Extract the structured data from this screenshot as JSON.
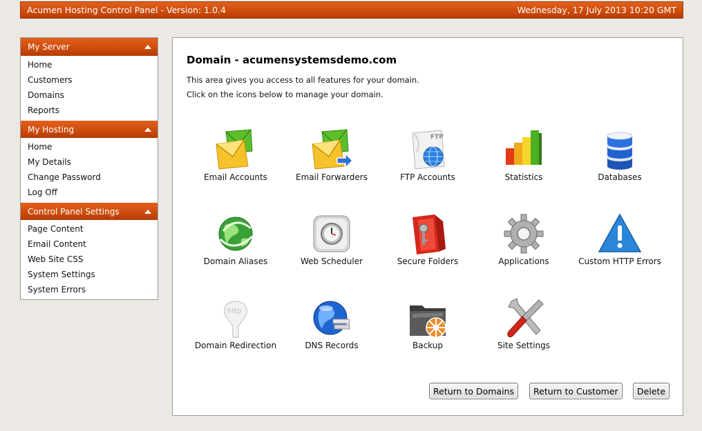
{
  "header": {
    "title": "Acumen Hosting Control Panel - Version: 1.0.4",
    "datetime": "Wednesday, 17 July 2013 10:20 GMT"
  },
  "sidebar": {
    "sections": [
      {
        "title": "My Server",
        "items": [
          "Home",
          "Customers",
          "Domains",
          "Reports"
        ]
      },
      {
        "title": "My Hosting",
        "items": [
          "Home",
          "My Details",
          "Change Password",
          "Log Off"
        ]
      },
      {
        "title": "Control Panel Settings",
        "items": [
          "Page Content",
          "Email Content",
          "Web Site CSS",
          "System Settings",
          "System Errors"
        ]
      }
    ]
  },
  "main": {
    "title": "Domain - acumensystemsdemo.com",
    "desc1": "This area gives you access to all features for your domain.",
    "desc2": "Click on the icons below to manage your domain.",
    "tiles": [
      {
        "label": "Email Accounts",
        "icon": "email-accounts-icon"
      },
      {
        "label": "Email Forwarders",
        "icon": "email-forwarders-icon"
      },
      {
        "label": "FTP Accounts",
        "icon": "ftp-accounts-icon",
        "badge": "FTP"
      },
      {
        "label": "Statistics",
        "icon": "statistics-icon"
      },
      {
        "label": "Databases",
        "icon": "databases-icon"
      },
      {
        "label": "Domain Aliases",
        "icon": "domain-aliases-icon"
      },
      {
        "label": "Web Scheduler",
        "icon": "web-scheduler-icon"
      },
      {
        "label": "Secure Folders",
        "icon": "secure-folders-icon"
      },
      {
        "label": "Applications",
        "icon": "applications-icon"
      },
      {
        "label": "Custom HTTP Errors",
        "icon": "custom-http-errors-icon"
      },
      {
        "label": "Domain Redirection",
        "icon": "domain-redirection-icon",
        "badge": "http"
      },
      {
        "label": "DNS Records",
        "icon": "dns-records-icon"
      },
      {
        "label": "Backup",
        "icon": "backup-icon"
      },
      {
        "label": "Site Settings",
        "icon": "site-settings-icon"
      }
    ],
    "buttons": {
      "return_domains": "Return to Domains",
      "return_customer": "Return to Customer",
      "delete": "Delete"
    }
  },
  "colors": {
    "header_orange": "#cf4d0e",
    "page_bg": "#ece9e4"
  }
}
